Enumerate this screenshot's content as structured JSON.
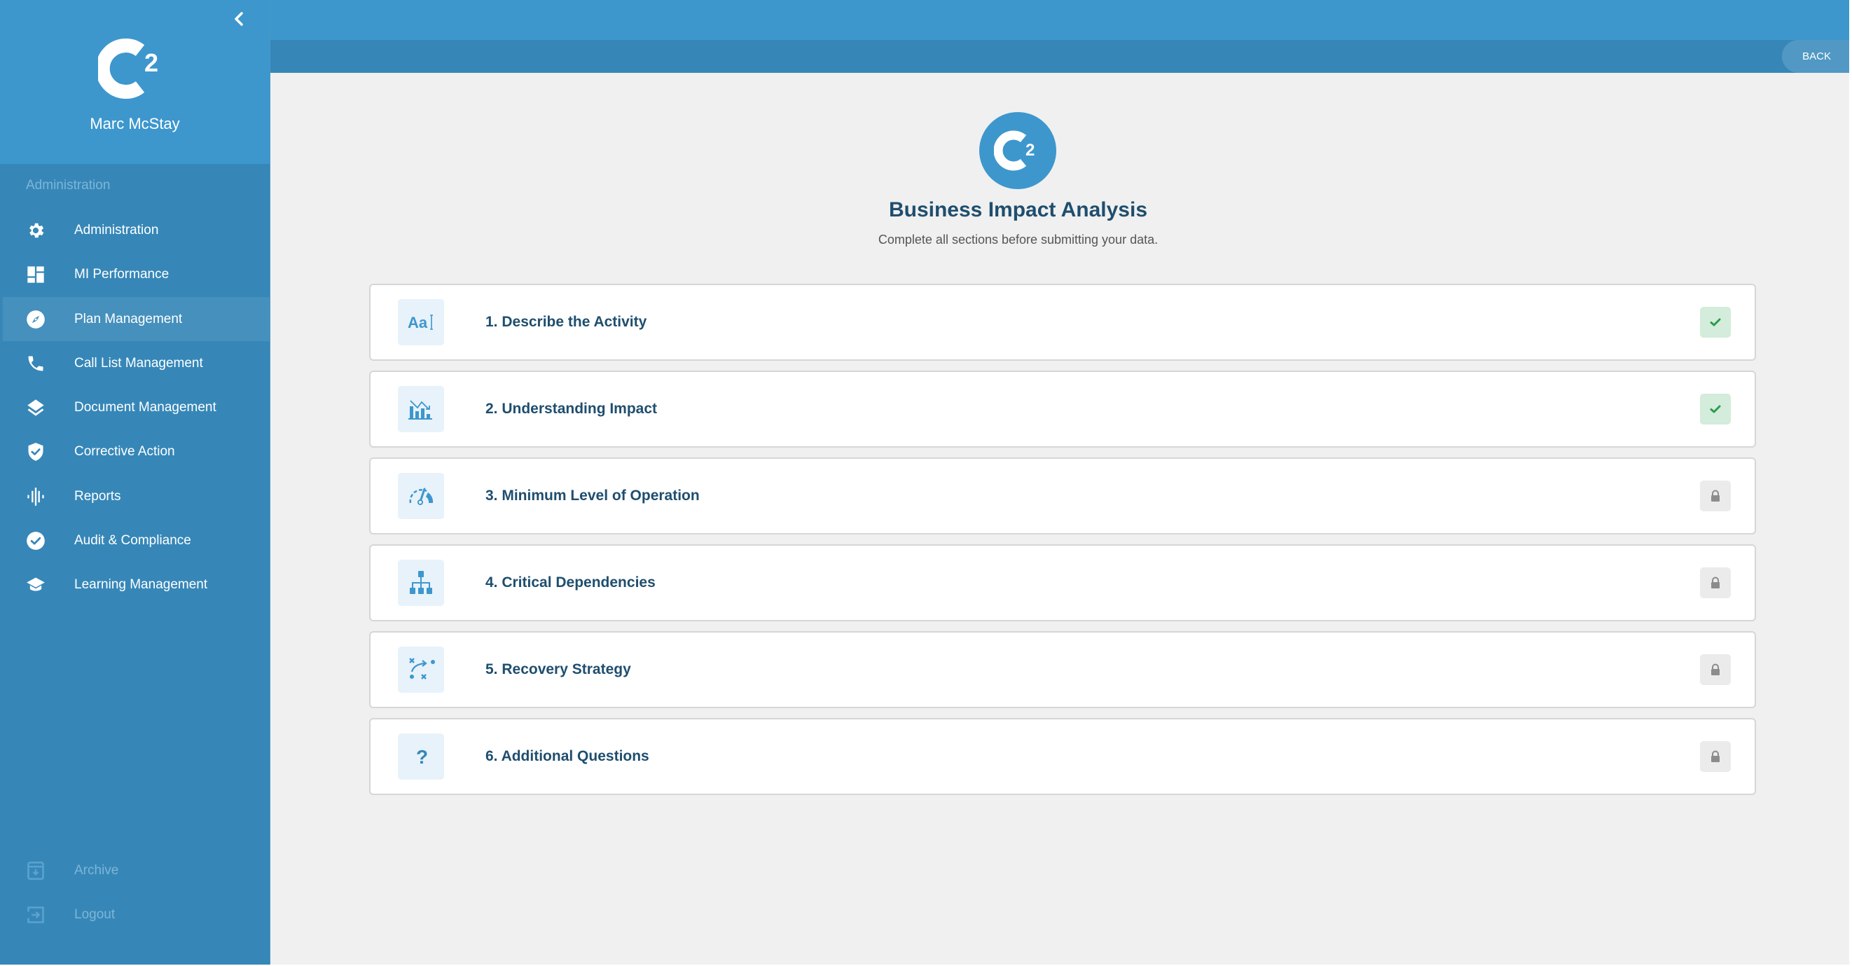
{
  "sidebar": {
    "user_name": "Marc McStay",
    "section_label": "Administration",
    "items": [
      {
        "label": "Administration",
        "icon": "gear-icon",
        "active": false
      },
      {
        "label": "MI Performance",
        "icon": "dashboard-icon",
        "active": false
      },
      {
        "label": "Plan Management",
        "icon": "compass-icon",
        "active": true
      },
      {
        "label": "Call List Management",
        "icon": "phone-icon",
        "active": false
      },
      {
        "label": "Document Management",
        "icon": "layers-icon",
        "active": false
      },
      {
        "label": "Corrective Action",
        "icon": "shield-check-icon",
        "active": false
      },
      {
        "label": "Reports",
        "icon": "waveform-icon",
        "active": false
      },
      {
        "label": "Audit & Compliance",
        "icon": "check-circle-icon",
        "active": false
      },
      {
        "label": "Learning Management",
        "icon": "graduation-cap-icon",
        "active": false
      }
    ],
    "footer_items": [
      {
        "label": "Archive",
        "icon": "archive-icon"
      },
      {
        "label": "Logout",
        "icon": "logout-icon"
      }
    ]
  },
  "topbar": {
    "back_label": "BACK"
  },
  "header": {
    "title": "Business Impact Analysis",
    "subtitle": "Complete all sections before submitting your data."
  },
  "sections": [
    {
      "title": "1. Describe the Activity",
      "icon": "text-format-icon",
      "status": "complete"
    },
    {
      "title": "2. Understanding Impact",
      "icon": "chart-decline-icon",
      "status": "complete"
    },
    {
      "title": "3. Minimum Level of Operation",
      "icon": "speedometer-icon",
      "status": "locked"
    },
    {
      "title": "4. Critical Dependencies",
      "icon": "hierarchy-icon",
      "status": "locked"
    },
    {
      "title": "5. Recovery Strategy",
      "icon": "strategy-icon",
      "status": "locked"
    },
    {
      "title": "6. Additional Questions",
      "icon": "question-icon",
      "status": "locked"
    }
  ],
  "colors": {
    "primary": "#3d97cd",
    "primary_dark": "#3687b8",
    "title_navy": "#1f4e6e",
    "complete_green": "#2a9d4a",
    "complete_bg": "#d4ecdb",
    "locked_gray": "#8c8c8c"
  }
}
